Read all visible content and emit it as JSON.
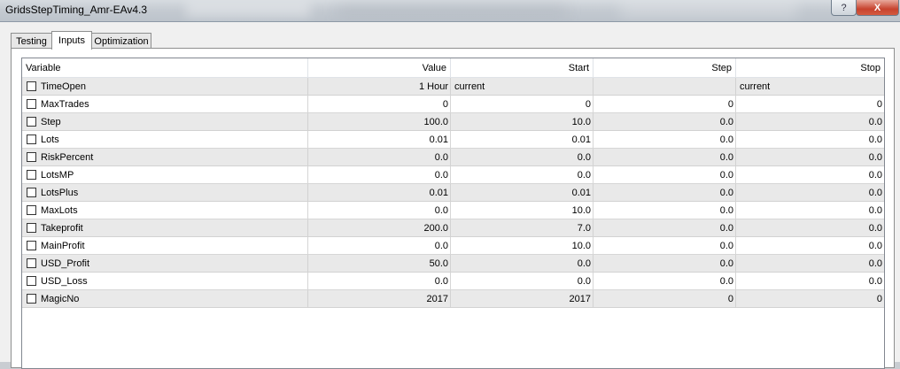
{
  "window": {
    "title": "GridsStepTiming_Amr-EAv4.3",
    "help_label": "?",
    "close_label": "X"
  },
  "tabs": [
    "Testing",
    "Inputs",
    "Optimization"
  ],
  "active_tab": "Inputs",
  "columns": [
    "Variable",
    "Value",
    "Start",
    "Step",
    "Stop"
  ],
  "rows": [
    {
      "variable": "TimeOpen",
      "value": "1 Hour",
      "start": "current",
      "step": "",
      "stop": "current",
      "checked": false
    },
    {
      "variable": "MaxTrades",
      "value": "0",
      "start": "0",
      "step": "0",
      "stop": "0",
      "checked": false
    },
    {
      "variable": "Step",
      "value": "100.0",
      "start": "10.0",
      "step": "0.0",
      "stop": "0.0",
      "checked": false
    },
    {
      "variable": "Lots",
      "value": "0.01",
      "start": "0.01",
      "step": "0.0",
      "stop": "0.0",
      "checked": false
    },
    {
      "variable": "RiskPercent",
      "value": "0.0",
      "start": "0.0",
      "step": "0.0",
      "stop": "0.0",
      "checked": false
    },
    {
      "variable": "LotsMP",
      "value": "0.0",
      "start": "0.0",
      "step": "0.0",
      "stop": "0.0",
      "checked": false
    },
    {
      "variable": "LotsPlus",
      "value": "0.01",
      "start": "0.01",
      "step": "0.0",
      "stop": "0.0",
      "checked": false
    },
    {
      "variable": "MaxLots",
      "value": "0.0",
      "start": "10.0",
      "step": "0.0",
      "stop": "0.0",
      "checked": false
    },
    {
      "variable": "Takeprofit",
      "value": "200.0",
      "start": "7.0",
      "step": "0.0",
      "stop": "0.0",
      "checked": false
    },
    {
      "variable": "MainProfit",
      "value": "0.0",
      "start": "10.0",
      "step": "0.0",
      "stop": "0.0",
      "checked": false
    },
    {
      "variable": "USD_Profit",
      "value": "50.0",
      "start": "0.0",
      "step": "0.0",
      "stop": "0.0",
      "checked": false
    },
    {
      "variable": "USD_Loss",
      "value": "0.0",
      "start": "0.0",
      "step": "0.0",
      "stop": "0.0",
      "checked": false
    },
    {
      "variable": "MagicNo",
      "value": "2017",
      "start": "2017",
      "step": "0",
      "stop": "0",
      "checked": false
    }
  ]
}
